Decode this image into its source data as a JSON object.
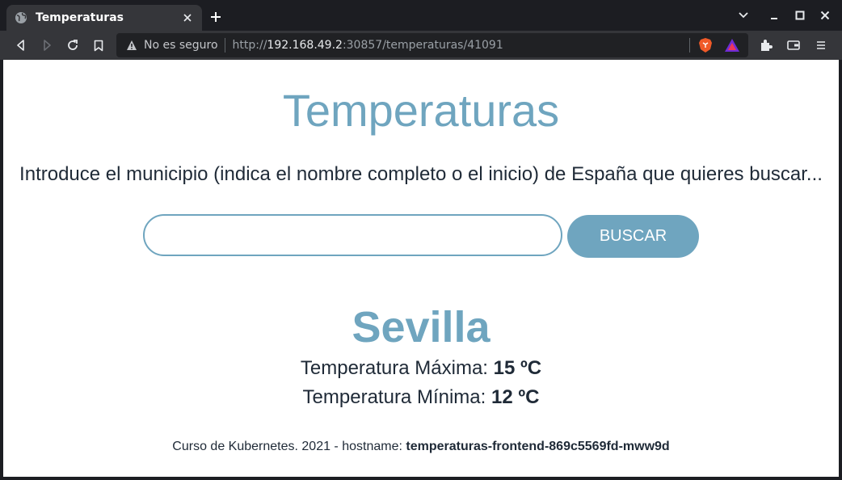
{
  "browser": {
    "tab_title": "Temperaturas",
    "security_label": "No es seguro",
    "url": {
      "scheme": "http://",
      "host": "192.168.49.2",
      "rest": ":30857/temperaturas/41091"
    },
    "icons": [
      "globe-icon",
      "close-icon",
      "plus-icon",
      "chevron-down-icon",
      "minimize-icon",
      "maximize-icon",
      "close-window-icon",
      "back-icon",
      "forward-icon",
      "reload-icon",
      "bookmark-icon",
      "warning-icon",
      "brave-shields-icon",
      "brave-rewards-icon",
      "extensions-icon",
      "wallet-icon",
      "menu-icon"
    ]
  },
  "page": {
    "title": "Temperaturas",
    "instructions": "Introduce el municipio (indica el nombre completo o el inicio) de España que quieres buscar...",
    "search": {
      "value": "",
      "placeholder": "",
      "button_label": "BUSCAR"
    },
    "result": {
      "city": "Sevilla",
      "max_label": "Temperatura Máxima:",
      "max_value": "15 ºC",
      "min_label": "Temperatura Mínima:",
      "min_value": "12 ºC"
    },
    "footer": {
      "text": "Curso de Kubernetes. 2021 - hostname:",
      "hostname": "temperaturas-frontend-869c5569fd-mww9d"
    }
  },
  "colors": {
    "accent": "#6fa5bf",
    "text": "#1f2a37",
    "chrome_bg": "#1c1d22",
    "toolbar_bg": "#35363a"
  }
}
